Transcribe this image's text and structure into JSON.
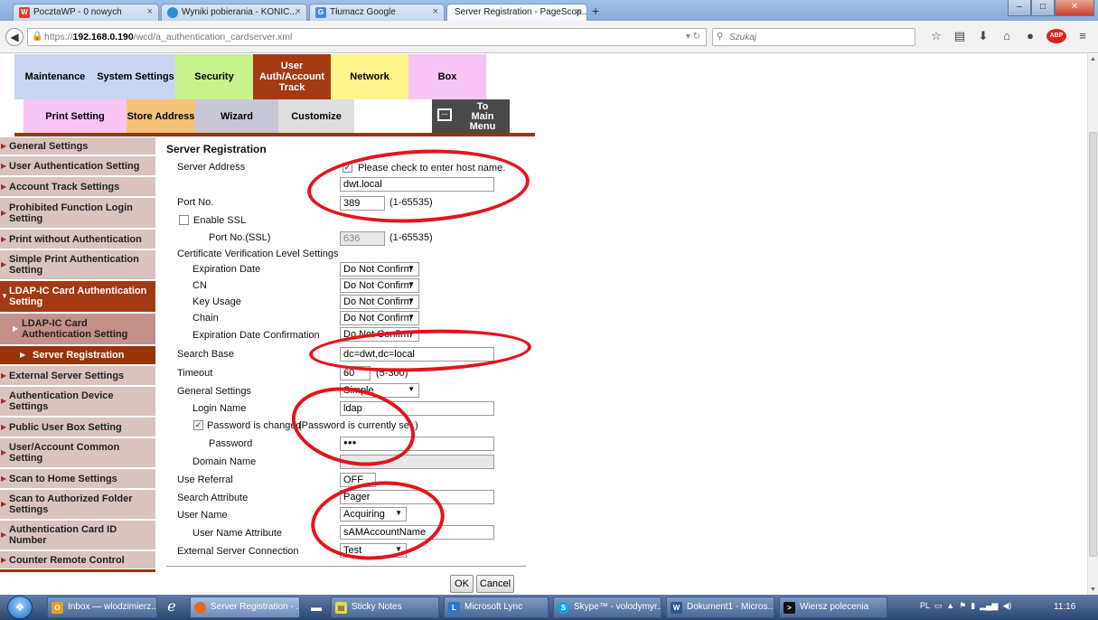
{
  "browser": {
    "tabs": [
      {
        "label": "PocztaWP - 0 nowych",
        "icon": "wp-icon"
      },
      {
        "label": "Wyniki pobierania - KONIC...",
        "icon": "search-engine-icon"
      },
      {
        "label": "Tłumacz Google",
        "icon": "translate-icon"
      },
      {
        "label": "Server Registration - PageScop...",
        "icon": "page-icon"
      }
    ],
    "new_tab": "+",
    "url_prefix": "https://",
    "url_host": "192.168.0.190",
    "url_path": "/wcd/a_authentication_cardserver.xml",
    "search_placeholder": "Szukaj"
  },
  "top_menu": {
    "maintenance": "Maintenance",
    "system_settings": "System Settings",
    "security": "Security",
    "user_auth": "User Auth/Account Track",
    "network": "Network",
    "box": "Box"
  },
  "sub_menu": {
    "print_setting": "Print Setting",
    "store_address": "Store Address",
    "wizard": "Wizard",
    "customize": "Customize",
    "to_main_menu": "To Main Menu"
  },
  "sidebar": [
    "General Settings",
    "User Authentication Setting",
    "Account Track Settings",
    "Prohibited Function Login Setting",
    "Print without Authentication",
    "Simple Print Authentication Setting",
    "LDAP-IC Card Authentication Setting",
    "LDAP-IC Card Authentication Setting",
    "Server Registration",
    "External Server Settings",
    "Authentication Device Settings",
    "Public User Box Setting",
    "User/Account Common Setting",
    "Scan to Home Settings",
    "Scan to Authorized Folder Settings",
    "Authentication Card ID Number",
    "Counter Remote Control"
  ],
  "form": {
    "title": "Server Registration",
    "server_address_label": "Server Address",
    "host_name_check_label": "Please check to enter host name.",
    "server_address_value": "dwt.local",
    "port_label": "Port No.",
    "port_value": "389",
    "port_range": "(1-65535)",
    "enable_ssl_label": "Enable SSL",
    "port_ssl_label": "Port No.(SSL)",
    "port_ssl_value": "636",
    "port_ssl_range": "(1-65535)",
    "cert_level_label": "Certificate Verification Level Settings",
    "expiration_date_label": "Expiration Date",
    "expiration_date_value": "Do Not Confirm",
    "cn_label": "CN",
    "cn_value": "Do Not Confirm",
    "key_usage_label": "Key Usage",
    "key_usage_value": "Do Not Confirm",
    "chain_label": "Chain",
    "chain_value": "Do Not Confirm",
    "exp_date_confirm_label": "Expiration Date Confirmation",
    "exp_date_confirm_value": "Do Not Confirm",
    "search_base_label": "Search Base",
    "search_base_value": "dc=dwt,dc=local",
    "timeout_label": "Timeout",
    "timeout_value": "60",
    "timeout_range": "(5-300)",
    "general_settings_label": "General Settings",
    "general_settings_value": "Simple",
    "login_name_label": "Login Name",
    "login_name_value": "ldap",
    "password_changed_label": "Password is changed.",
    "password_set_note": "(Password is currently set.)",
    "password_label": "Password",
    "password_value": "●●●",
    "domain_name_label": "Domain Name",
    "domain_name_value": "",
    "use_referral_label": "Use Referral",
    "use_referral_value": "OFF",
    "search_attribute_label": "Search Attribute",
    "search_attribute_value": "Pager",
    "user_name_label": "User Name",
    "user_name_value": "Acquiring",
    "user_name_attr_label": "User Name Attribute",
    "user_name_attr_value": "sAMAccountName",
    "ext_server_conn_label": "External Server Connection",
    "ext_server_conn_value": "Test",
    "ok": "OK",
    "cancel": "Cancel"
  },
  "taskbar": {
    "items": [
      "Inbox — wlodzimierz...",
      "Server Registration - ...",
      "Sticky Notes",
      "Microsoft Lync",
      "Skype™ - volodymyr...",
      "Dokument1 - Micros...",
      "Wiersz polecenia"
    ],
    "lang": "PL",
    "clock": "11:16"
  },
  "colors": {
    "maintenance": "#c9d5ee",
    "system_settings": "#c9d5ee",
    "security": "#c8f28c",
    "user_auth": "#a33a14",
    "network": "#fff58c",
    "box": "#f6c5f4",
    "annotation_red": "#e4141b"
  }
}
